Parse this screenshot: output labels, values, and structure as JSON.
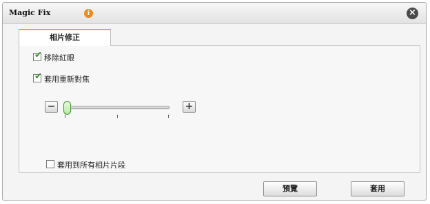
{
  "window": {
    "title": "Magic Fix",
    "info_icon": "i",
    "close_icon": "×"
  },
  "tabs": [
    {
      "label": "相片修正",
      "active": true
    }
  ],
  "options": [
    {
      "label": "移除紅眼",
      "checked": true
    },
    {
      "label": "套用重新對焦",
      "checked": true
    }
  ],
  "slider": {
    "minus_label": "−",
    "plus_label": "+",
    "value": 0.02
  },
  "apply_all": {
    "label": "套用到所有相片片段",
    "checked": false
  },
  "buttons": {
    "preview_label": "預覽",
    "apply_label": "套用"
  },
  "colors": {
    "accent_tab": "#f0a13a",
    "check_green": "#3a8f2a",
    "info_orange": "#f08a1c"
  }
}
